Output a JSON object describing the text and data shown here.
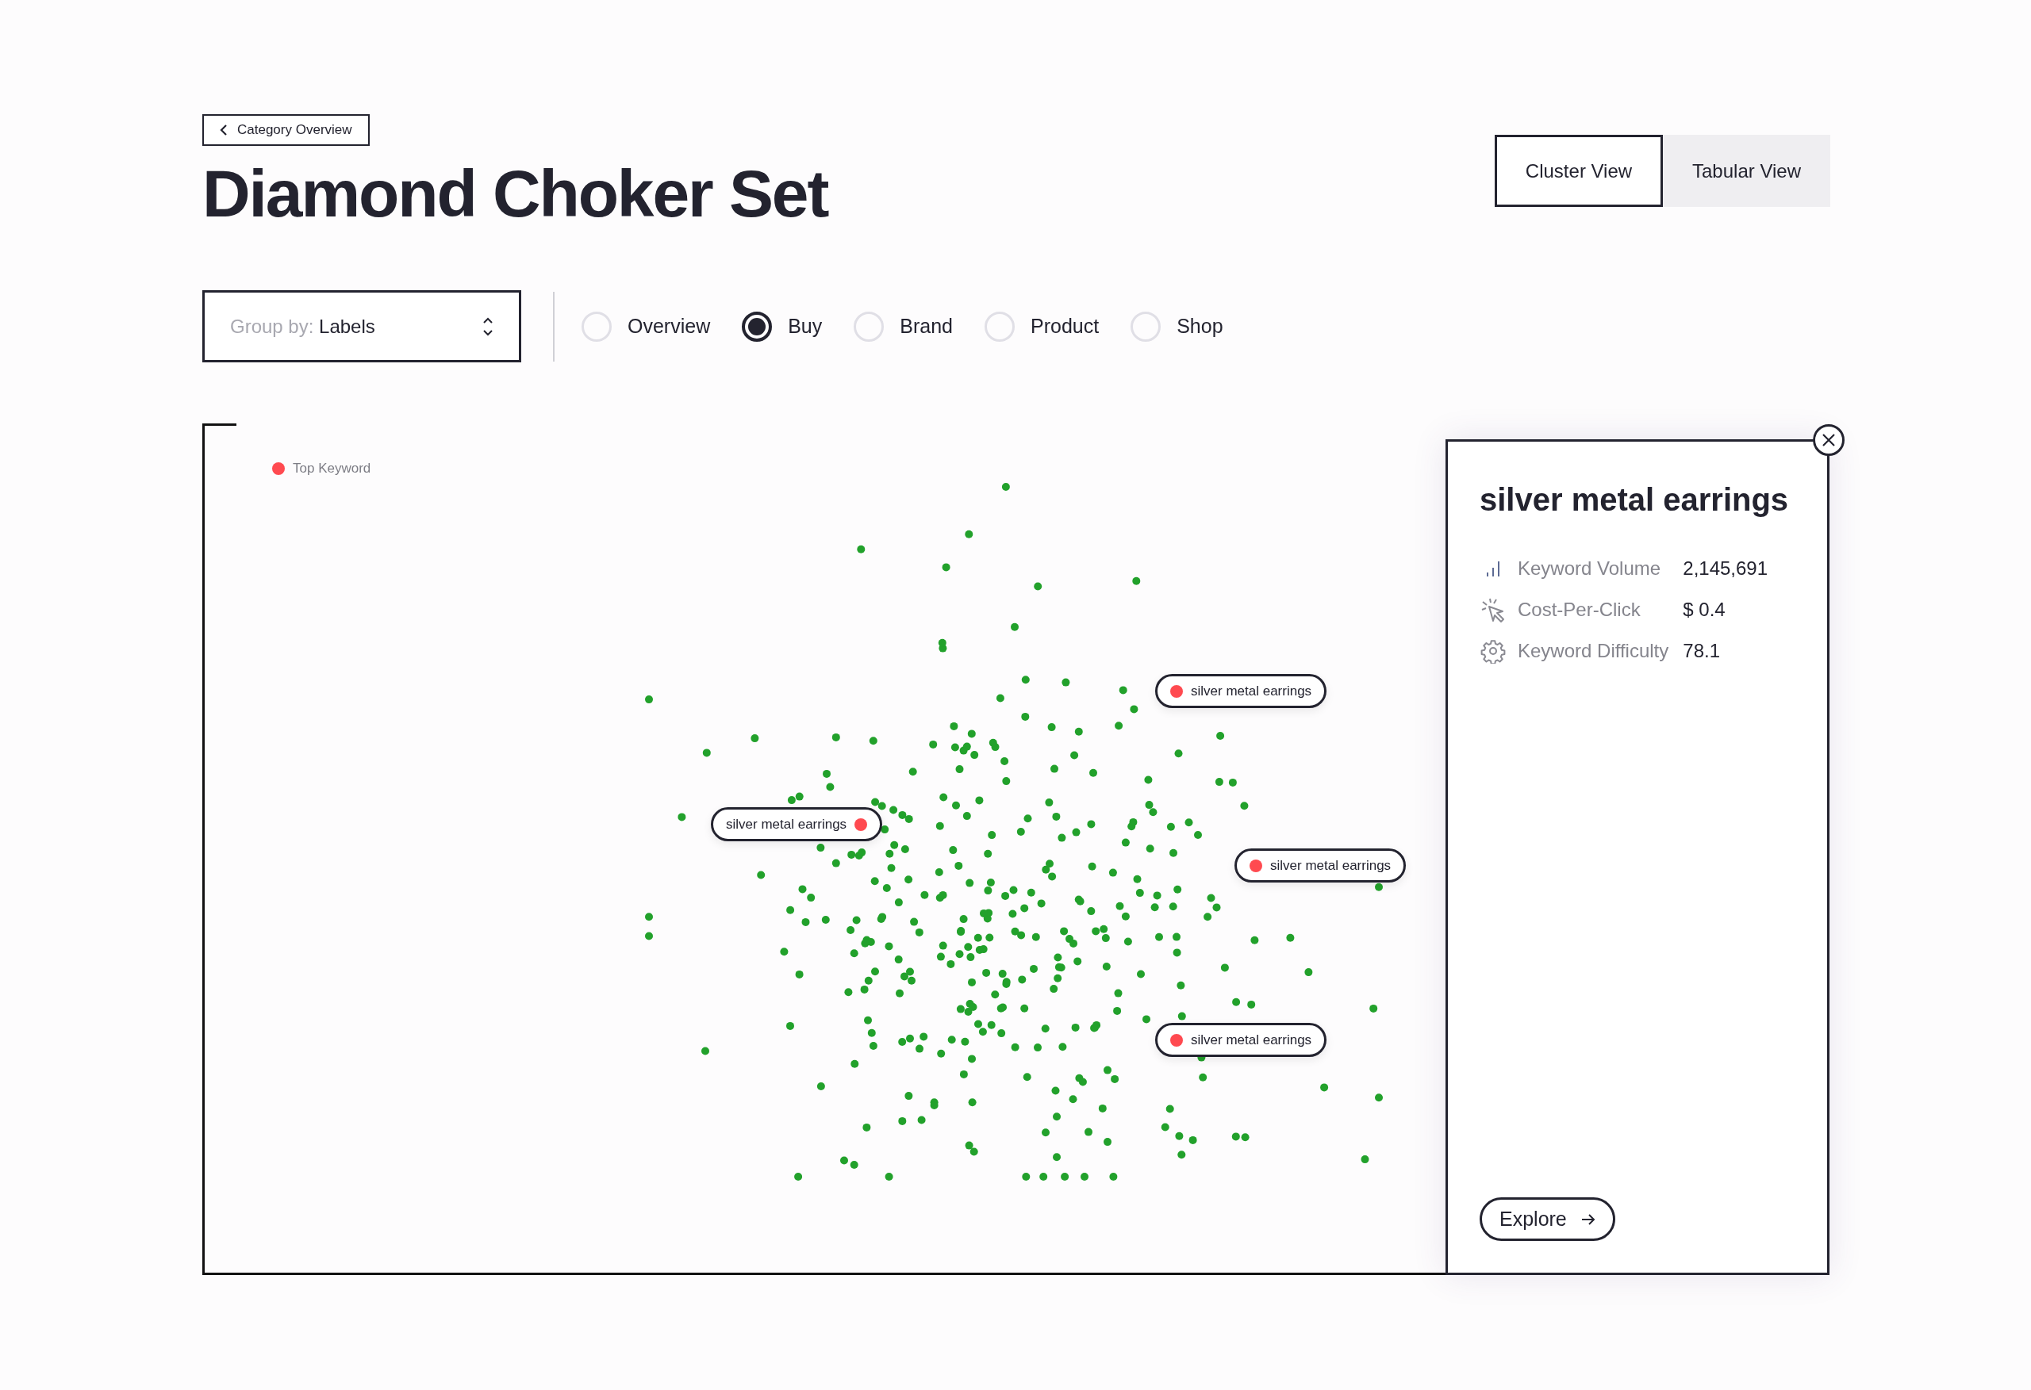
{
  "back_link": {
    "label": "Category Overview"
  },
  "title": "Diamond Choker Set",
  "view_toggle": [
    {
      "label": "Cluster View",
      "selected": true
    },
    {
      "label": "Tabular View",
      "selected": false
    }
  ],
  "group_by": {
    "label": "Group by:",
    "value": "Labels"
  },
  "filters": [
    {
      "label": "Overview",
      "selected": false
    },
    {
      "label": "Buy",
      "selected": true
    },
    {
      "label": "Brand",
      "selected": false
    },
    {
      "label": "Product",
      "selected": false
    },
    {
      "label": "Shop",
      "selected": false
    }
  ],
  "chart": {
    "legend": {
      "label": "Top Keyword"
    },
    "keyword_labels": [
      {
        "text": "silver metal earrings",
        "kind": "leading"
      },
      {
        "text": "silver metal earrings",
        "kind": "trailing"
      },
      {
        "text": "silver metal earrings",
        "kind": "leading"
      },
      {
        "text": "silver metal earrings",
        "kind": "leading"
      }
    ]
  },
  "detail_panel": {
    "title": "silver metal earrings",
    "metrics": [
      {
        "kind": "volume",
        "label": "Keyword Volume",
        "value": "2,145,691"
      },
      {
        "kind": "cpc",
        "label": "Cost-Per-Click",
        "value": "$ 0.4"
      },
      {
        "kind": "difficulty",
        "label": "Keyword Difficulty",
        "value": "78.1"
      }
    ],
    "explore_button": "Explore"
  }
}
